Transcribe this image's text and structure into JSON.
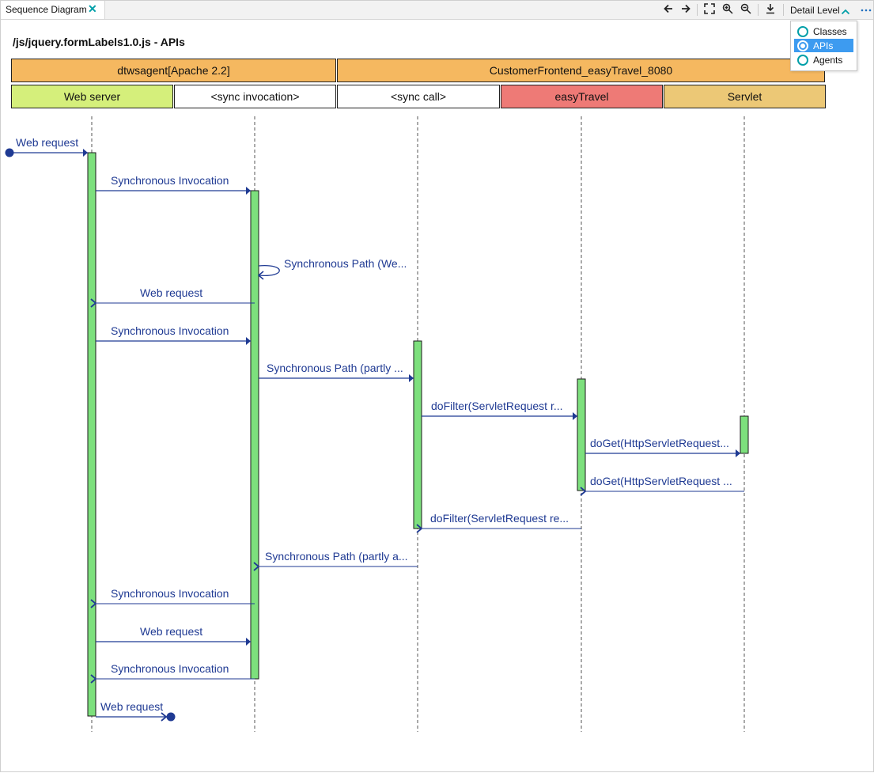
{
  "tab": {
    "title": "Sequence Diagram"
  },
  "toolbar": {
    "icons": [
      "arrow-left-icon",
      "arrow-right-icon",
      "fit-screen-icon",
      "zoom-in-icon",
      "zoom-out-icon",
      "download-icon"
    ],
    "detail_level_label": "Detail Level"
  },
  "detail_level_menu": {
    "options": [
      {
        "label": "Classes",
        "selected": false
      },
      {
        "label": "APIs",
        "selected": true
      },
      {
        "label": "Agents",
        "selected": false
      }
    ]
  },
  "diagram": {
    "title": "/js/jquery.formLabels1.0.js - APIs",
    "groups": [
      "dtwsagent[Apache 2.2]",
      "CustomerFrontend_easyTravel_8080"
    ],
    "lifelines": [
      {
        "label": "Web server",
        "color": "#d5ef7b"
      },
      {
        "label": "<sync invocation>",
        "color": "#ffffff"
      },
      {
        "label": "<sync call>",
        "color": "#ffffff"
      },
      {
        "label": "easyTravel",
        "color": "#ee7a76"
      },
      {
        "label": "Servlet",
        "color": "#ecc876"
      }
    ],
    "group_color": "#f5b860",
    "messages": [
      {
        "label": "Web request",
        "from": "start",
        "to": 0,
        "style": "solid"
      },
      {
        "label": "Synchronous Invocation",
        "from": 0,
        "to": 1,
        "style": "solid"
      },
      {
        "label": "Synchronous Path (We...",
        "from": 1,
        "to": 1,
        "style": "self"
      },
      {
        "label": "Web request",
        "from": 1,
        "to": 0,
        "style": "return"
      },
      {
        "label": "Synchronous Invocation",
        "from": 0,
        "to": 1,
        "style": "solid"
      },
      {
        "label": "Synchronous Path (partly ...",
        "from": 1,
        "to": 2,
        "style": "solid"
      },
      {
        "label": "doFilter(ServletRequest r...",
        "from": 2,
        "to": 3,
        "style": "solid"
      },
      {
        "label": "doGet(HttpServletRequest...",
        "from": 3,
        "to": 4,
        "style": "solid"
      },
      {
        "label": "doGet(HttpServletRequest ...",
        "from": 4,
        "to": 3,
        "style": "return"
      },
      {
        "label": "doFilter(ServletRequest re...",
        "from": 3,
        "to": 2,
        "style": "return"
      },
      {
        "label": "Synchronous Path (partly a...",
        "from": 2,
        "to": 1,
        "style": "return"
      },
      {
        "label": "Synchronous Invocation",
        "from": 1,
        "to": 0,
        "style": "return"
      },
      {
        "label": "Web request",
        "from": 0,
        "to": 1,
        "style": "solid"
      },
      {
        "label": "Synchronous Invocation",
        "from": 1,
        "to": 0,
        "style": "return"
      },
      {
        "label": "Web request",
        "from": 0,
        "to": "end",
        "style": "solid"
      }
    ],
    "colors": {
      "message": "#1f3a93",
      "activation_fill": "#7de07d",
      "activation_stroke": "#1a1a1a"
    }
  }
}
